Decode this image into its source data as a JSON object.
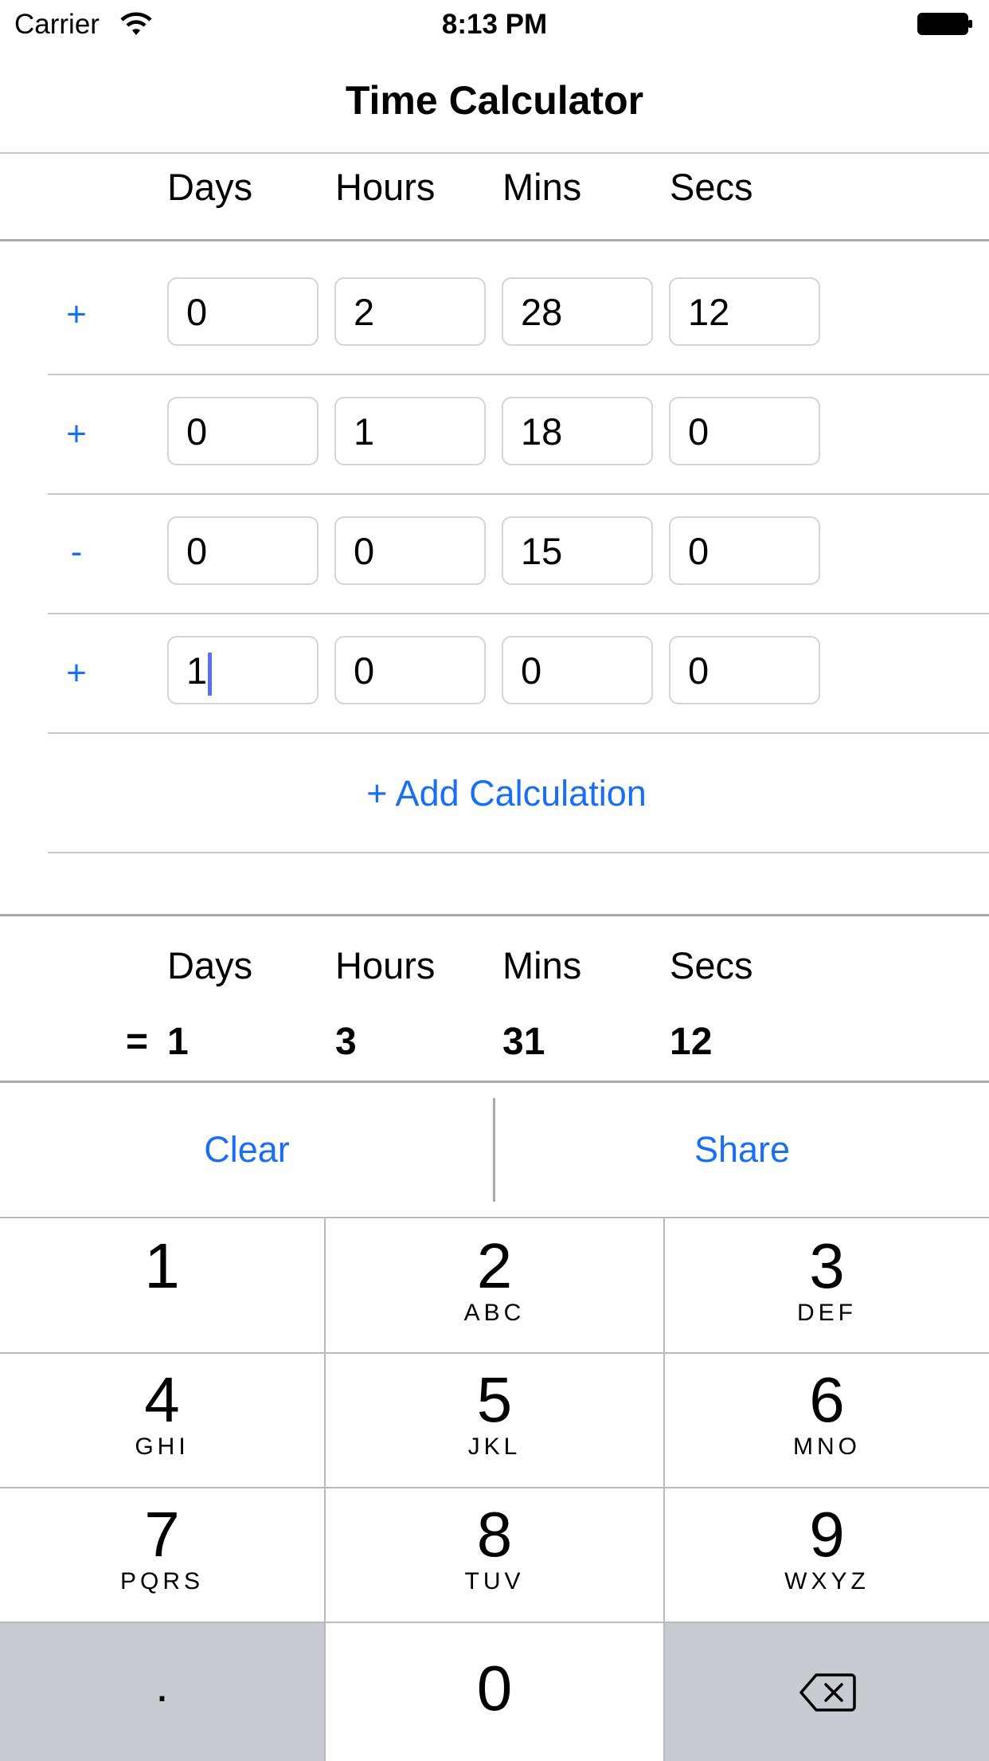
{
  "status_bar": {
    "carrier": "Carrier",
    "time": "8:13 PM"
  },
  "nav": {
    "title": "Time Calculator"
  },
  "columns": {
    "days": "Days",
    "hours": "Hours",
    "mins": "Mins",
    "secs": "Secs"
  },
  "rows": [
    {
      "sign": "+",
      "days": "0",
      "hours": "2",
      "mins": "28",
      "secs": "12"
    },
    {
      "sign": "+",
      "days": "0",
      "hours": "1",
      "mins": "18",
      "secs": "0"
    },
    {
      "sign": "-",
      "days": "0",
      "hours": "0",
      "mins": "15",
      "secs": "0"
    },
    {
      "sign": "+",
      "days": "1",
      "hours": "0",
      "mins": "0",
      "secs": "0"
    }
  ],
  "add_calculation": "+ Add Calculation",
  "result": {
    "labels": {
      "days": "Days",
      "hours": "Hours",
      "mins": "Mins",
      "secs": "Secs"
    },
    "equals": "=",
    "days": "1",
    "hours": "3",
    "mins": "31",
    "secs": "12"
  },
  "actions": {
    "clear": "Clear",
    "share": "Share"
  },
  "keypad": {
    "keys": [
      {
        "num": "1",
        "letters": ""
      },
      {
        "num": "2",
        "letters": "ABC"
      },
      {
        "num": "3",
        "letters": "DEF"
      },
      {
        "num": "4",
        "letters": "GHI"
      },
      {
        "num": "5",
        "letters": "JKL"
      },
      {
        "num": "6",
        "letters": "MNO"
      },
      {
        "num": "7",
        "letters": "PQRS"
      },
      {
        "num": "8",
        "letters": "TUV"
      },
      {
        "num": "9",
        "letters": "WXYZ"
      }
    ],
    "dot": ".",
    "zero": "0",
    "delete_icon": "backspace-icon"
  },
  "colors": {
    "accent": "#1a6ef5",
    "keypad_dark": "#c9cbd2",
    "caret": "#5b6ff0"
  }
}
